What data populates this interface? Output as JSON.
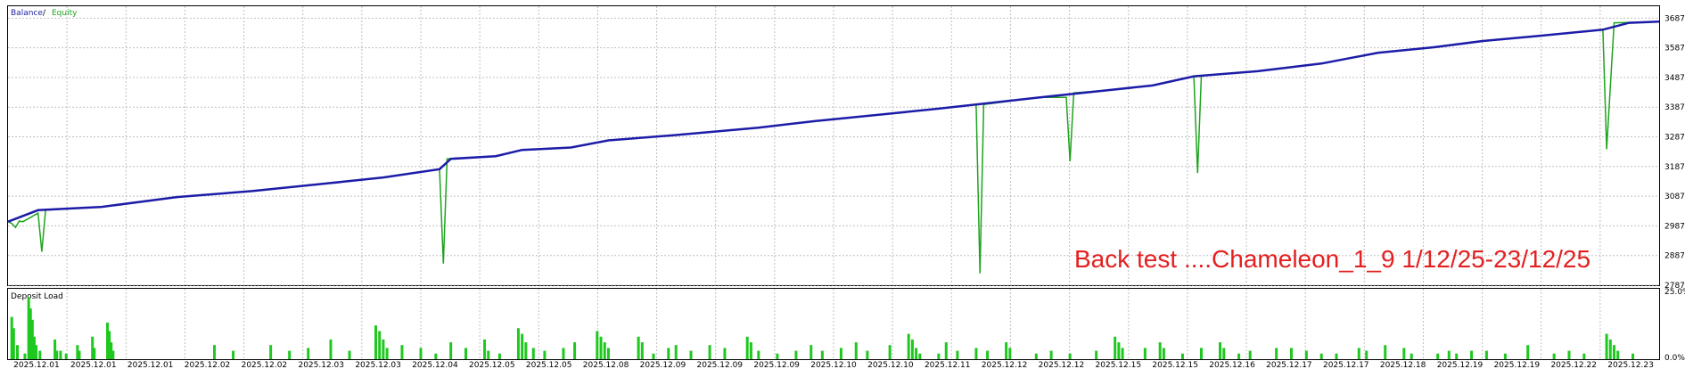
{
  "colors": {
    "background": "#ffffff",
    "grid": "#c0c0c0",
    "frame": "#000000",
    "balance": "#1c1ca8",
    "equity": "#1ea41e",
    "deposit_load": "#1ec81e",
    "annotation": "#e32020"
  },
  "chart_data": [
    {
      "type": "line",
      "title": "",
      "legend": {
        "placement": "top-left",
        "balance_label": "Balance",
        "separator": " / ",
        "equity_label": "Equity"
      },
      "annotation": "Back test ....Chameleon_1_9   1/12/25-23/12/25",
      "ylim": [
        2787,
        3727
      ],
      "y_ticks": [
        "3687",
        "3587",
        "3487",
        "3387",
        "3287",
        "3187",
        "3087",
        "2987",
        "2887",
        "2787"
      ],
      "y_tick_values": [
        3687,
        3587,
        3487,
        3387,
        3287,
        3187,
        3087,
        2987,
        2887,
        2787
      ],
      "grid": true,
      "n_points": 200,
      "series": [
        {
          "name": "Balance",
          "points": [
            [
              0,
              3001
            ],
            [
              8,
              3040
            ],
            [
              25,
              3051
            ],
            [
              45,
              3084
            ],
            [
              65,
              3104
            ],
            [
              85,
              3130
            ],
            [
              100,
              3150
            ],
            [
              115,
              3178
            ],
            [
              118,
              3213
            ],
            [
              130,
              3222
            ],
            [
              137,
              3243
            ],
            [
              150,
              3251
            ],
            [
              160,
              3275
            ],
            [
              180,
              3295
            ],
            [
              200,
              3318
            ],
            [
              215,
              3340
            ],
            [
              235,
              3365
            ],
            [
              248,
              3382
            ],
            [
              258,
              3396
            ],
            [
              275,
              3420
            ],
            [
              293,
              3444
            ],
            [
              305,
              3460
            ],
            [
              316,
              3491
            ],
            [
              333,
              3508
            ],
            [
              350,
              3534
            ],
            [
              365,
              3570
            ],
            [
              380,
              3589
            ],
            [
              393,
              3610
            ],
            [
              408,
              3627
            ],
            [
              425,
              3648
            ],
            [
              432,
              3671
            ],
            [
              440,
              3675
            ]
          ]
        },
        {
          "name": "Equity",
          "points": [
            [
              0,
              3001
            ],
            [
              1,
              2995
            ],
            [
              2,
              2982
            ],
            [
              3,
              3003
            ],
            [
              4,
              3001
            ],
            [
              8,
              3030
            ],
            [
              9,
              2900
            ],
            [
              10,
              3040
            ],
            [
              25,
              3051
            ],
            [
              45,
              3084
            ],
            [
              65,
              3104
            ],
            [
              85,
              3130
            ],
            [
              100,
              3150
            ],
            [
              115,
              3178
            ],
            [
              116,
              2860
            ],
            [
              117,
              3213
            ],
            [
              130,
              3222
            ],
            [
              137,
              3243
            ],
            [
              150,
              3251
            ],
            [
              160,
              3275
            ],
            [
              180,
              3295
            ],
            [
              200,
              3318
            ],
            [
              215,
              3340
            ],
            [
              235,
              3365
            ],
            [
              248,
              3382
            ],
            [
              258,
              3396
            ],
            [
              259,
              2827
            ],
            [
              260,
              3396
            ],
            [
              275,
              3420
            ],
            [
              282,
              3420
            ],
            [
              283,
              3205
            ],
            [
              284,
              3435
            ],
            [
              293,
              3444
            ],
            [
              305,
              3460
            ],
            [
              316,
              3491
            ],
            [
              317,
              3165
            ],
            [
              318,
              3493
            ],
            [
              333,
              3508
            ],
            [
              350,
              3534
            ],
            [
              365,
              3570
            ],
            [
              380,
              3589
            ],
            [
              393,
              3610
            ],
            [
              408,
              3627
            ],
            [
              425,
              3648
            ],
            [
              426,
              3245
            ],
            [
              428,
              3671
            ],
            [
              440,
              3675
            ]
          ]
        }
      ]
    },
    {
      "type": "bar",
      "title": "Deposit Load",
      "ylim": [
        0,
        25
      ],
      "y_ticks": [
        "25.0%",
        "0.0%"
      ],
      "y_tick_values": [
        25,
        0
      ],
      "grid": true,
      "n_points": 200,
      "bar_x": [
        0,
        1,
        2,
        3,
        4,
        5,
        6,
        7,
        8,
        9,
        10,
        11,
        12,
        13,
        14,
        15,
        16,
        17,
        18,
        19,
        20,
        21,
        22,
        23,
        24,
        25,
        26,
        27,
        28,
        29,
        30,
        31,
        32,
        33,
        34,
        35,
        36,
        37,
        38,
        39,
        40,
        41,
        42,
        43,
        44,
        45,
        46,
        47,
        48,
        49,
        50,
        51,
        52,
        53,
        54,
        55,
        56,
        57,
        58,
        59,
        60,
        61,
        62,
        63,
        64,
        65,
        66,
        67,
        68,
        69,
        70,
        71,
        72,
        73,
        74,
        75,
        76,
        77,
        78,
        79,
        80,
        81,
        82,
        83,
        84,
        85,
        86,
        87,
        88,
        89,
        90,
        91,
        92,
        93,
        94,
        95,
        96,
        97,
        98,
        99,
        100,
        101,
        102,
        103,
        104,
        105,
        106,
        107,
        108,
        109,
        110,
        111,
        112,
        113,
        114,
        115,
        116,
        117,
        118,
        119,
        120,
        121,
        122,
        123,
        124,
        125,
        126,
        127,
        128,
        129,
        130,
        131,
        132,
        133,
        134,
        135,
        136,
        137,
        138,
        139,
        140,
        141,
        142,
        143,
        144,
        145,
        146,
        147,
        148,
        149,
        150,
        151,
        152,
        153,
        154,
        155,
        156,
        157,
        158,
        159,
        160,
        161,
        162,
        163,
        164,
        165,
        166,
        167,
        168,
        169,
        170,
        171,
        172,
        173,
        174,
        175,
        176,
        177,
        178,
        179,
        180,
        181,
        182,
        183,
        184,
        185,
        186,
        187,
        188,
        189,
        190,
        191,
        192,
        193,
        194,
        195,
        196,
        197,
        198,
        199
      ],
      "values": [
        0,
        0,
        15,
        11,
        0,
        5,
        0,
        0,
        0,
        2,
        0,
        22,
        18,
        14,
        8,
        5,
        0,
        3,
        0,
        0,
        0,
        0,
        0,
        0,
        0,
        7,
        3,
        0,
        3,
        0,
        0,
        2,
        0,
        0,
        0,
        0,
        0,
        5,
        3,
        0,
        0,
        0,
        0,
        0,
        0,
        8,
        4,
        0,
        0,
        0,
        0,
        0,
        0,
        13,
        10,
        6,
        3,
        0,
        0,
        0,
        0,
        0,
        0,
        0,
        0,
        0,
        0,
        0,
        0,
        0,
        0,
        0,
        0,
        0,
        0,
        0,
        0,
        0,
        0,
        0,
        0,
        0,
        0,
        0,
        0,
        0,
        0,
        0,
        0,
        0,
        0,
        0,
        0,
        0,
        0,
        0,
        0,
        0,
        0,
        0,
        0,
        0,
        0,
        0,
        0,
        0,
        0,
        0,
        0,
        0,
        0,
        0,
        0,
        0,
        0,
        0,
        0,
        0,
        0,
        0,
        0,
        0,
        0,
        0,
        0,
        0,
        0,
        0,
        0,
        0,
        0,
        0,
        0,
        0,
        0,
        0,
        0,
        0,
        0,
        0,
        0,
        0,
        0,
        0,
        0,
        0,
        0,
        0,
        0,
        0,
        0,
        0,
        0,
        0,
        0,
        0,
        0,
        0,
        0,
        0,
        0,
        0,
        0,
        0,
        0,
        0,
        0,
        0,
        0,
        0,
        0,
        0,
        0,
        0,
        0,
        0,
        0,
        0,
        0,
        0,
        0,
        0,
        0,
        0,
        0,
        0,
        0,
        0,
        0,
        0,
        0,
        0,
        0,
        0,
        0,
        0,
        0,
        0,
        0,
        0
      ],
      "bar_x_extra": [
        [
          55,
          5
        ],
        [
          60,
          3
        ],
        [
          70,
          5
        ],
        [
          75,
          3
        ],
        [
          80,
          4
        ],
        [
          86,
          7
        ],
        [
          91,
          3
        ],
        [
          98,
          12
        ],
        [
          99,
          10
        ],
        [
          100,
          7
        ],
        [
          101,
          4
        ],
        [
          105,
          5
        ],
        [
          110,
          4
        ],
        [
          114,
          2
        ],
        [
          118,
          6
        ],
        [
          122,
          4
        ],
        [
          127,
          7
        ],
        [
          128,
          3
        ],
        [
          131,
          2
        ],
        [
          136,
          11
        ],
        [
          137,
          9
        ],
        [
          138,
          6
        ],
        [
          140,
          4
        ],
        [
          143,
          3
        ],
        [
          148,
          4
        ],
        [
          151,
          6
        ],
        [
          157,
          10
        ],
        [
          158,
          8
        ],
        [
          159,
          6
        ],
        [
          160,
          4
        ],
        [
          168,
          8
        ],
        [
          169,
          6
        ],
        [
          172,
          2
        ],
        [
          176,
          4
        ],
        [
          178,
          5
        ],
        [
          182,
          3
        ],
        [
          187,
          5
        ],
        [
          191,
          4
        ],
        [
          197,
          8
        ],
        [
          198,
          6
        ],
        [
          200,
          3
        ],
        [
          205,
          2
        ],
        [
          210,
          3
        ],
        [
          214,
          5
        ],
        [
          217,
          3
        ],
        [
          222,
          4
        ],
        [
          226,
          6
        ],
        [
          229,
          3
        ],
        [
          235,
          5
        ],
        [
          240,
          9
        ],
        [
          241,
          7
        ],
        [
          242,
          4
        ],
        [
          243,
          2
        ],
        [
          248,
          2
        ],
        [
          250,
          6
        ],
        [
          253,
          3
        ],
        [
          258,
          4
        ],
        [
          261,
          3
        ],
        [
          266,
          6
        ],
        [
          267,
          4
        ],
        [
          274,
          2
        ],
        [
          278,
          3
        ],
        [
          283,
          2
        ],
        [
          290,
          3
        ],
        [
          295,
          8
        ],
        [
          296,
          6
        ],
        [
          297,
          4
        ],
        [
          303,
          4
        ],
        [
          307,
          6
        ],
        [
          308,
          4
        ],
        [
          313,
          2
        ],
        [
          318,
          4
        ],
        [
          323,
          6
        ],
        [
          324,
          4
        ],
        [
          328,
          2
        ],
        [
          331,
          3
        ],
        [
          338,
          4
        ],
        [
          342,
          4
        ],
        [
          346,
          3
        ],
        [
          350,
          2
        ],
        [
          354,
          2
        ],
        [
          360,
          4
        ],
        [
          362,
          3
        ],
        [
          367,
          5
        ],
        [
          372,
          4
        ],
        [
          374,
          2
        ],
        [
          381,
          2
        ],
        [
          384,
          3
        ],
        [
          386,
          2
        ],
        [
          390,
          3
        ],
        [
          394,
          3
        ],
        [
          399,
          2
        ],
        [
          405,
          5
        ],
        [
          412,
          2
        ],
        [
          416,
          3
        ],
        [
          420,
          2
        ],
        [
          426,
          9
        ],
        [
          427,
          7
        ],
        [
          428,
          5
        ],
        [
          429,
          3
        ],
        [
          433,
          2
        ]
      ]
    }
  ],
  "x_axis_labels": [
    "2025.12.01",
    "2025.12.01",
    "2025.12.01",
    "2025.12.02",
    "2025.12.02",
    "2025.12.03",
    "2025.12.03",
    "2025.12.04",
    "2025.12.05",
    "2025.12.05",
    "2025.12.08",
    "2025.12.09",
    "2025.12.09",
    "2025.12.09",
    "2025.12.10",
    "2025.12.10",
    "2025.12.11",
    "2025.12.12",
    "2025.12.12",
    "2025.12.15",
    "2025.12.15",
    "2025.12.16",
    "2025.12.17",
    "2025.12.17",
    "2025.12.18",
    "2025.12.19",
    "2025.12.19",
    "2025.12.22",
    "2025.12.23"
  ]
}
